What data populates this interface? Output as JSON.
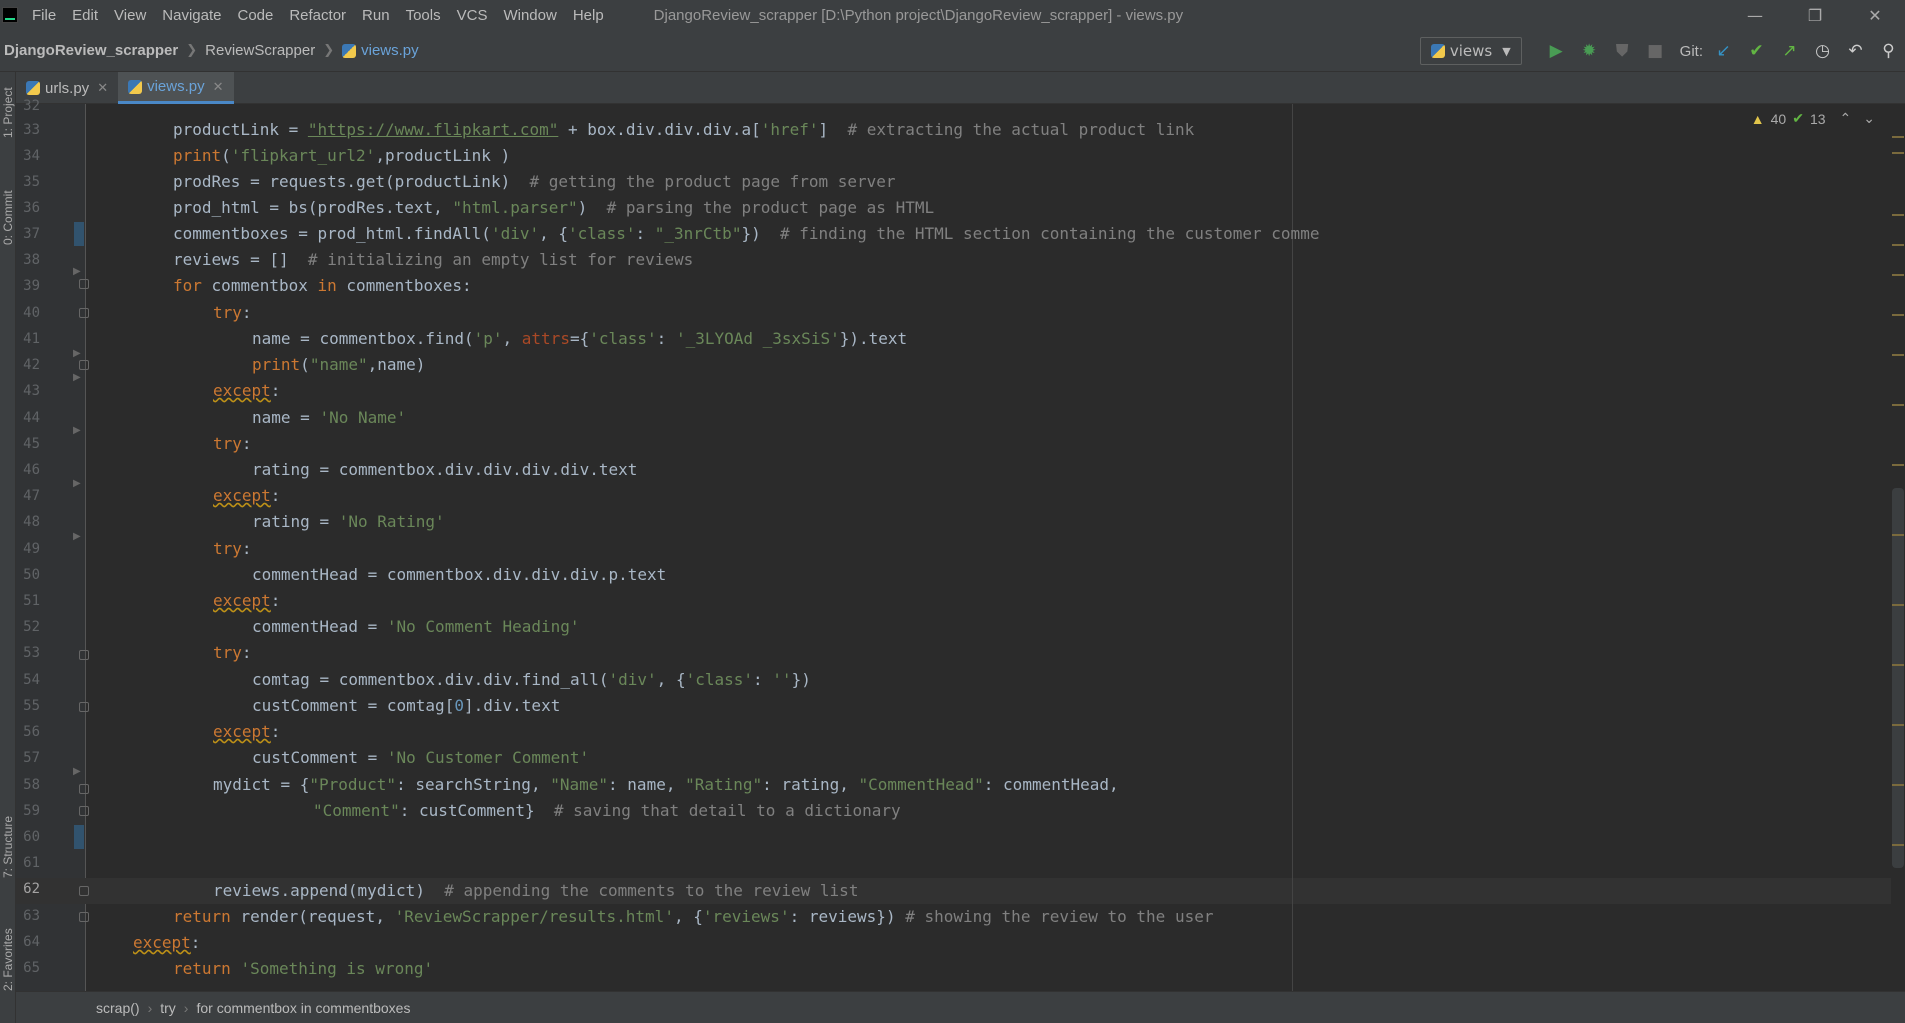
{
  "window": {
    "title": "DjangoReview_scrapper [D:\\Python project\\DjangoReview_scrapper] - views.py",
    "controls": [
      "—",
      "❐",
      "✕"
    ]
  },
  "menu": [
    "File",
    "Edit",
    "View",
    "Navigate",
    "Code",
    "Refactor",
    "Run",
    "Tools",
    "VCS",
    "Window",
    "Help"
  ],
  "breadcrumb": {
    "project": "DjangoReview_scrapper",
    "folder": "ReviewScrapper",
    "file": "views.py"
  },
  "toolbar": {
    "run_config": "views",
    "git_label": "Git:"
  },
  "tabs": [
    {
      "label": "urls.py",
      "active": false
    },
    {
      "label": "views.py",
      "active": true
    }
  ],
  "left_tools": [
    "1: Project",
    "0: Commit",
    "7: Structure",
    "2: Favorites"
  ],
  "inspections": {
    "warnings": "40",
    "ok": "13"
  },
  "editor": {
    "current_line": "62",
    "lines": [
      {
        "n": "32",
        "code": ""
      },
      {
        "n": "33",
        "code": "productLink = \"https://www.flipkart.com\" + box.div.div.div.a['href']  # extracting the actual product link"
      },
      {
        "n": "34",
        "code": "print('flipkart_url2',productLink )"
      },
      {
        "n": "35",
        "code": "prodRes = requests.get(productLink)  # getting the product page from server"
      },
      {
        "n": "36",
        "code": "prod_html = bs(prodRes.text, \"html.parser\")  # parsing the product page as HTML"
      },
      {
        "n": "37",
        "code": "commentboxes = prod_html.findAll('div', {'class': \"_3nrCtb\"})  # finding the HTML section containing the customer comme"
      },
      {
        "n": "38",
        "code": "reviews = []  # initializing an empty list for reviews"
      },
      {
        "n": "39",
        "code": "for commentbox in commentboxes:"
      },
      {
        "n": "40",
        "code": "try:"
      },
      {
        "n": "41",
        "code": "name = commentbox.find('p', attrs={'class': '_3LYOAd _3sxSiS'}).text"
      },
      {
        "n": "42",
        "code": "print(\"name\",name)"
      },
      {
        "n": "43",
        "code": "except:"
      },
      {
        "n": "44",
        "code": "name = 'No Name'"
      },
      {
        "n": "45",
        "code": "try:"
      },
      {
        "n": "46",
        "code": "rating = commentbox.div.div.div.div.text"
      },
      {
        "n": "47",
        "code": "except:"
      },
      {
        "n": "48",
        "code": "rating = 'No Rating'"
      },
      {
        "n": "49",
        "code": "try:"
      },
      {
        "n": "50",
        "code": "commentHead = commentbox.div.div.div.p.text"
      },
      {
        "n": "51",
        "code": "except:"
      },
      {
        "n": "52",
        "code": "commentHead = 'No Comment Heading'"
      },
      {
        "n": "53",
        "code": "try:"
      },
      {
        "n": "54",
        "code": "comtag = commentbox.div.div.find_all('div', {'class': ''})"
      },
      {
        "n": "55",
        "code": "custComment = comtag[0].div.text"
      },
      {
        "n": "56",
        "code": "except:"
      },
      {
        "n": "57",
        "code": "custComment = 'No Customer Comment'"
      },
      {
        "n": "58",
        "code": "mydict = {\"Product\": searchString, \"Name\": name, \"Rating\": rating, \"CommentHead\": commentHead,"
      },
      {
        "n": "59",
        "code": "\"Comment\": custComment}  # saving that detail to a dictionary"
      },
      {
        "n": "60",
        "code": ""
      },
      {
        "n": "61",
        "code": ""
      },
      {
        "n": "62",
        "code": "reviews.append(mydict)  # appending the comments to the review list"
      },
      {
        "n": "63",
        "code": "return render(request, 'ReviewScrapper/results.html', {'reviews': reviews}) # showing the review to the user"
      },
      {
        "n": "64",
        "code": "except:"
      },
      {
        "n": "65",
        "code": "return 'Something is wrong'"
      }
    ]
  },
  "footer_breadcrumb": [
    "scrap()",
    "try",
    "for commentbox in commentboxes"
  ]
}
